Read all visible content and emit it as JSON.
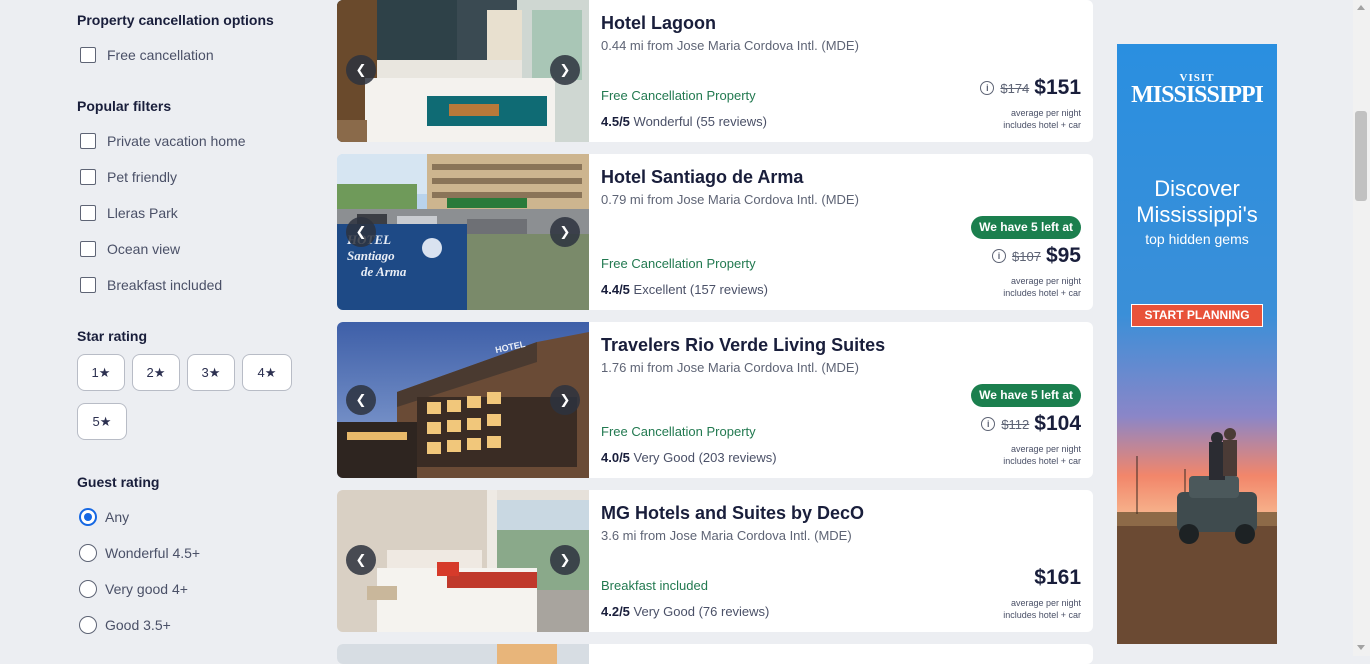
{
  "sidebar": {
    "cancellation": {
      "title": "Property cancellation options",
      "options": [
        "Free cancellation"
      ]
    },
    "popular": {
      "title": "Popular filters",
      "options": [
        "Private vacation home",
        "Pet friendly",
        "Lleras Park",
        "Ocean view",
        "Breakfast included"
      ]
    },
    "star_rating": {
      "title": "Star rating",
      "options": [
        "1★",
        "2★",
        "3★",
        "4★",
        "5★"
      ]
    },
    "guest_rating": {
      "title": "Guest rating",
      "selected": "Any",
      "options": [
        "Any",
        "Wonderful 4.5+",
        "Very good 4+",
        "Good 3.5+"
      ]
    }
  },
  "hotels": [
    {
      "name": "Hotel Lagoon",
      "distance": "0.44 mi from Jose Maria Cordova Intl. (MDE)",
      "feature": "Free Cancellation Property",
      "rating_score": "4.5/5",
      "rating_text": "Wonderful (55 reviews)",
      "badge": "",
      "old_price": "$174",
      "price": "$151",
      "sub1": "average per night",
      "sub2": "includes hotel + car"
    },
    {
      "name": "Hotel Santiago de Arma",
      "distance": "0.79 mi from Jose Maria Cordova Intl. (MDE)",
      "feature": "Free Cancellation Property",
      "rating_score": "4.4/5",
      "rating_text": "Excellent (157 reviews)",
      "badge": "We have 5 left at",
      "old_price": "$107",
      "price": "$95",
      "sub1": "average per night",
      "sub2": "includes hotel + car",
      "sign_line1": "HOTEL",
      "sign_line2": "Santiago",
      "sign_line3": "de Arma"
    },
    {
      "name": "Travelers Rio Verde Living Suites",
      "distance": "1.76 mi from Jose Maria Cordova Intl. (MDE)",
      "feature": "Free Cancellation Property",
      "rating_score": "4.0/5",
      "rating_text": "Very Good (203 reviews)",
      "badge": "We have 5 left at",
      "old_price": "$112",
      "price": "$104",
      "sub1": "average per night",
      "sub2": "includes hotel + car",
      "facade_sign": "HOTEL"
    },
    {
      "name": "MG Hotels and Suites by DecO",
      "distance": "3.6 mi from Jose Maria Cordova Intl. (MDE)",
      "feature": "Breakfast included",
      "rating_score": "4.2/5",
      "rating_text": "Very Good (76 reviews)",
      "badge": "",
      "old_price": "",
      "price": "$161",
      "sub1": "average per night",
      "sub2": "includes hotel + car"
    }
  ],
  "ad": {
    "logo_small": "VISIT",
    "logo_big": "MISSISSIPPI",
    "headline1": "Discover",
    "headline2": "Mississippi's",
    "tagline": "top hidden gems",
    "cta": "START PLANNING",
    "colors": {
      "sky_top": "#2a8fe0",
      "sunset": "#f2866a",
      "cta": "#e8523a"
    }
  },
  "colors": {
    "page_bg": "#eceef2",
    "feature_green": "#227950",
    "badge_green": "#1b7f4e",
    "radio_blue": "#1668e3"
  }
}
